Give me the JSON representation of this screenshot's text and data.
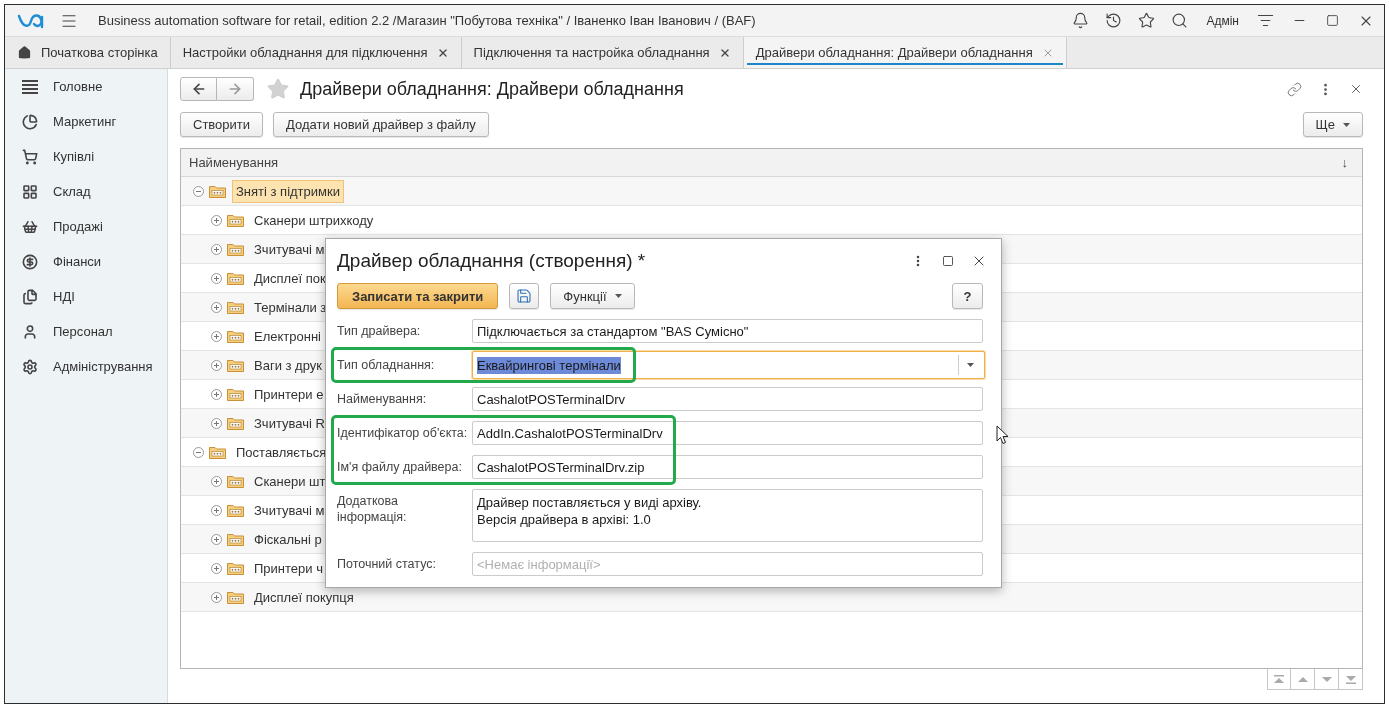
{
  "window": {
    "title": "Business automation software for retail, edition 2.2 /Магазин \"Побутова техніка\" / Іваненко Іван Іванович / (BAF)",
    "user": "Адмін"
  },
  "tabs": [
    {
      "label": "Початкова сторінка",
      "kind": "home",
      "selected": false
    },
    {
      "label": "Настройки обладнання для підключення",
      "kind": "document",
      "selected": false
    },
    {
      "label": "Підключення та настройка обладнання",
      "kind": "document",
      "selected": false
    },
    {
      "label": "Драйвери обладнання: Драйвери обладнання",
      "kind": "document",
      "selected": true
    }
  ],
  "sidebar": {
    "items": [
      {
        "label": "Головне"
      },
      {
        "label": "Маркетинг"
      },
      {
        "label": "Купівлі"
      },
      {
        "label": "Склад"
      },
      {
        "label": "Продажі"
      },
      {
        "label": "Фінанси"
      },
      {
        "label": "НДІ"
      },
      {
        "label": "Персонал"
      },
      {
        "label": "Адміністрування"
      }
    ]
  },
  "page": {
    "title": "Драйвери обладнання: Драйвери обладнання",
    "buttons": [
      "Створити",
      "Додати новий драйвер з файлу"
    ],
    "more_button": "Ще"
  },
  "table": {
    "columns": [
      {
        "label": "Найменування",
        "sort_mark": "↓"
      }
    ],
    "rows": [
      {
        "label": "Зняті з підтримки",
        "expanded": true,
        "selected": true,
        "children": [
          {
            "label": "Сканери штрихкоду",
            "expanded": false,
            "selected": false
          },
          {
            "label": "Зчитувачі м",
            "expanded": false,
            "selected": false
          },
          {
            "label": "Дисплеї пок",
            "expanded": false,
            "selected": false
          },
          {
            "label": "Термінали з",
            "expanded": false,
            "selected": false
          },
          {
            "label": "Електронні",
            "expanded": false,
            "selected": false
          },
          {
            "label": "Ваги з друк",
            "expanded": false,
            "selected": false
          },
          {
            "label": "Принтери е",
            "expanded": false,
            "selected": false
          },
          {
            "label": "Зчитувачі R",
            "expanded": false,
            "selected": false
          }
        ]
      },
      {
        "label": "Поставляється",
        "expanded": true,
        "selected": false,
        "children": [
          {
            "label": "Сканери шт",
            "expanded": false,
            "selected": false
          },
          {
            "label": "Зчитувачі м",
            "expanded": false,
            "selected": false
          },
          {
            "label": "Фіскальні р",
            "expanded": false,
            "selected": false
          },
          {
            "label": "Принтери ч",
            "expanded": false,
            "selected": false
          },
          {
            "label": "Дисплеї покупця",
            "expanded": false,
            "selected": false
          }
        ]
      }
    ]
  },
  "dialog": {
    "title": "Драйвер обладнання (створення) *",
    "primary_button": "Записати та закрити",
    "functions_button": "Функції",
    "help_button": "?",
    "fields": [
      {
        "label": "Тип драйвера:",
        "kind": "text",
        "value": "Підключається за стандартом \"BAS Сумісно\"",
        "focused": false,
        "text_selected": false,
        "highlighted": false
      },
      {
        "label": "Тип обладнання:",
        "kind": "select",
        "value": "Еквайрингові термінали",
        "focused": true,
        "text_selected": true,
        "highlighted": true
      },
      {
        "label": "Найменування:",
        "kind": "text",
        "value": "CashalotPOSTerminalDrv",
        "focused": false,
        "text_selected": false,
        "highlighted": false
      },
      {
        "label": "Ідентифікатор об'єкта:",
        "kind": "text",
        "value": "AddIn.CashalotPOSTerminalDrv",
        "focused": false,
        "text_selected": false,
        "highlighted": true
      },
      {
        "label": "Ім'я файлу драйвера:",
        "kind": "text",
        "value": "CashalotPOSTerminalDrv.zip",
        "focused": false,
        "text_selected": false,
        "highlighted": true
      },
      {
        "label": "Додаткова інформація:",
        "kind": "textarea",
        "value": "Драйвер поставляється у виді архіву.\nВерсія драйвера в архіві: 1.0",
        "focused": false,
        "text_selected": false,
        "highlighted": false
      },
      {
        "label": "Поточний статус:",
        "kind": "text",
        "placeholder": "<Немає інформації>",
        "focused": false,
        "text_selected": false,
        "highlighted": false
      }
    ]
  }
}
